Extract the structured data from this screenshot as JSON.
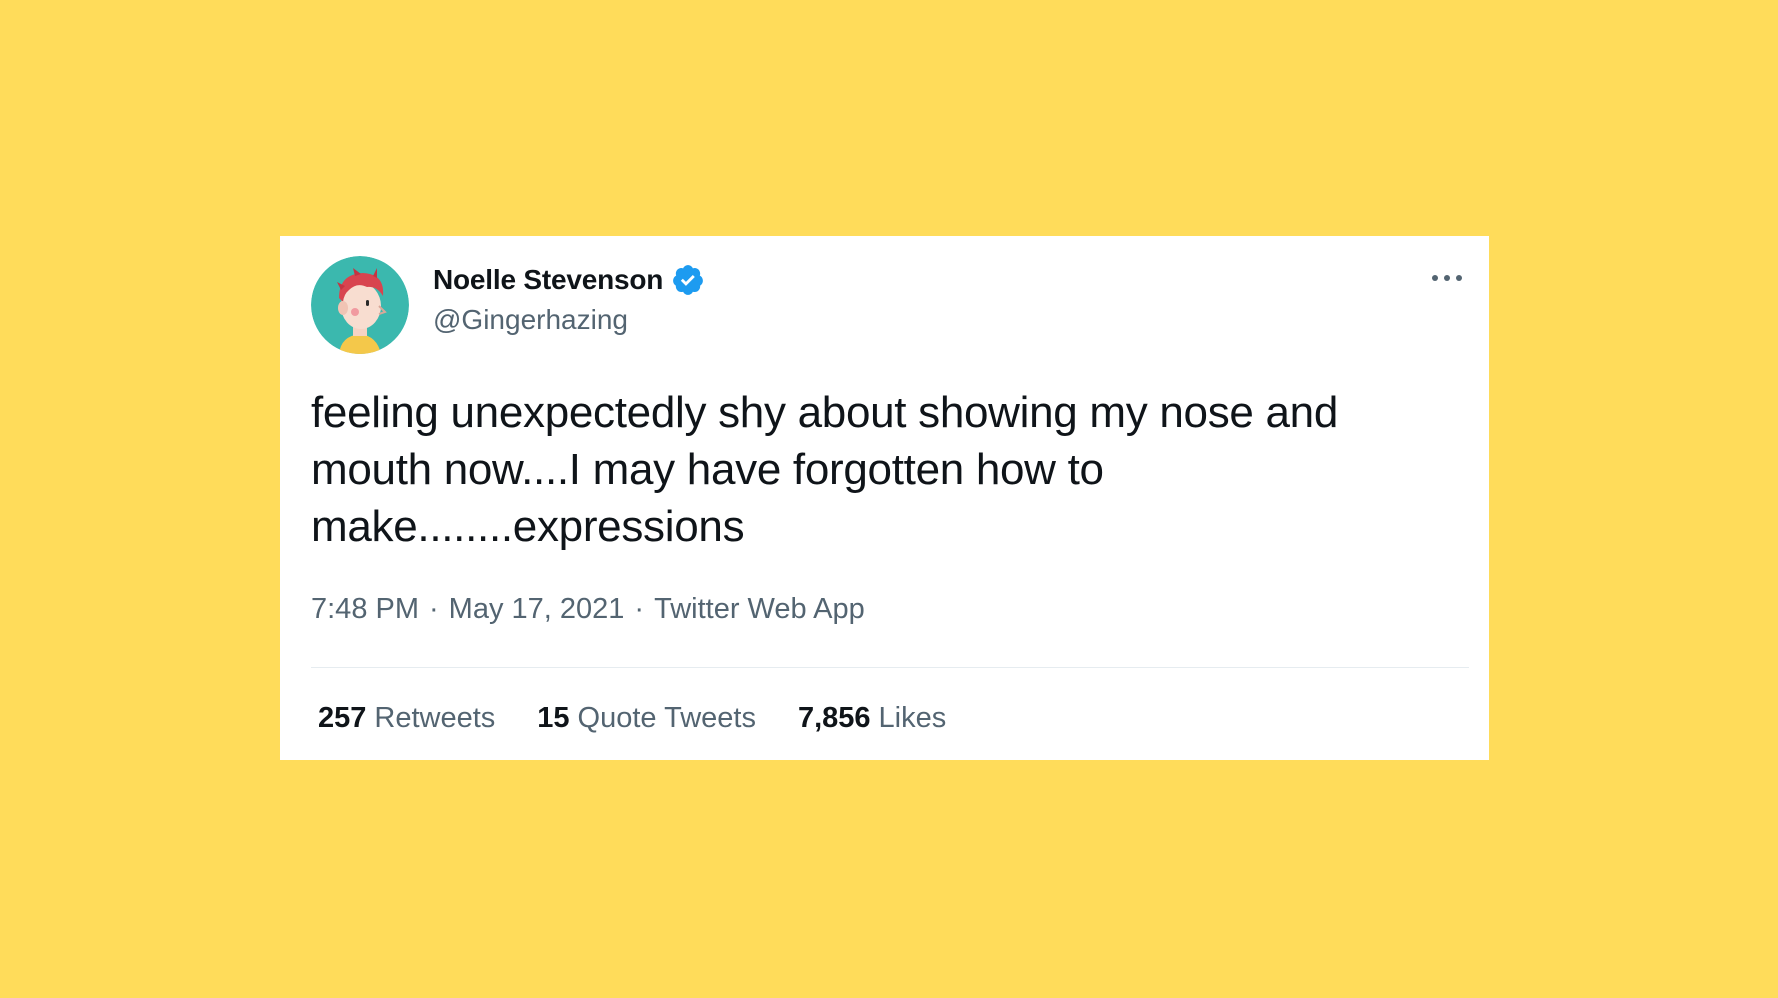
{
  "colors": {
    "background": "#FFDC5A",
    "card": "#FFFFFF",
    "text_primary": "#0F1419",
    "text_secondary": "#536471",
    "verified_blue": "#1D9BF0",
    "avatar_bg": "#3BB8AE"
  },
  "tweet": {
    "author": {
      "display_name": "Noelle Stevenson",
      "handle": "@Gingerhazing",
      "verified": true,
      "avatar_icon": "avatar-illustration",
      "verified_icon": "verified-badge-icon"
    },
    "more_icon": "more-options-icon",
    "text": "feeling unexpectedly shy about showing my nose and\nmouth now....I may have forgotten how to\nmake........expressions",
    "time": "7:48 PM",
    "separator": "·",
    "date": "May 17, 2021",
    "source": "Twitter Web App",
    "stats": {
      "retweets_count": "257",
      "retweets_label": "Retweets",
      "quotes_count": "15",
      "quotes_label": "Quote Tweets",
      "likes_count": "7,856",
      "likes_label": "Likes"
    }
  }
}
